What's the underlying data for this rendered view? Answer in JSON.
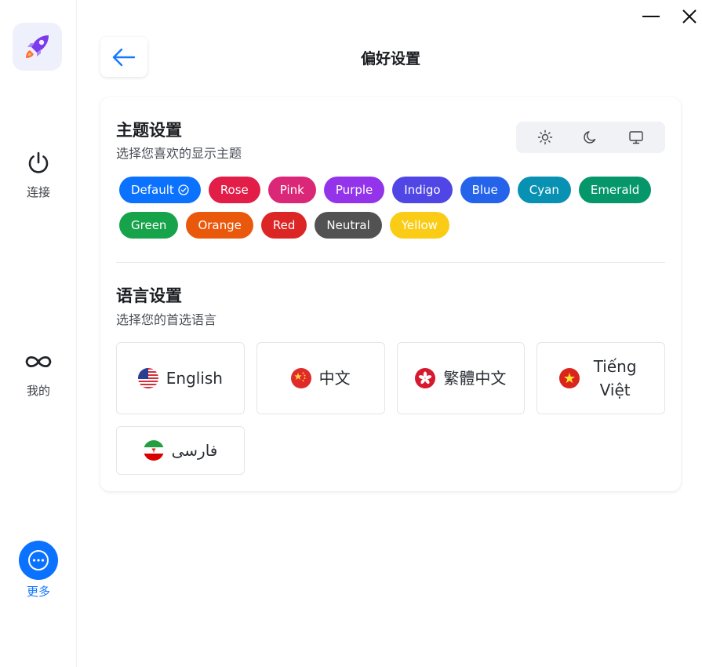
{
  "header": {
    "title": "偏好设置"
  },
  "sidebar": {
    "items": [
      {
        "label": "连接",
        "icon": "power-icon"
      },
      {
        "label": "我的",
        "icon": "infinity-icon"
      },
      {
        "label": "更多",
        "icon": "more-icon",
        "active": true
      }
    ]
  },
  "theme": {
    "title": "主题设置",
    "subtitle": "选择您喜欢的显示主题",
    "modes": [
      "sun-icon",
      "moon-icon",
      "monitor-icon"
    ],
    "colors": [
      {
        "label": "Default",
        "color": "#0a72ff",
        "selected": true
      },
      {
        "label": "Rose",
        "color": "#e11d48"
      },
      {
        "label": "Pink",
        "color": "#db2777"
      },
      {
        "label": "Purple",
        "color": "#9333ea"
      },
      {
        "label": "Indigo",
        "color": "#4f46e5"
      },
      {
        "label": "Blue",
        "color": "#2563eb"
      },
      {
        "label": "Cyan",
        "color": "#0891b2"
      },
      {
        "label": "Emerald",
        "color": "#059669"
      },
      {
        "label": "Green",
        "color": "#16a34a"
      },
      {
        "label": "Orange",
        "color": "#ea580c"
      },
      {
        "label": "Red",
        "color": "#dc2626"
      },
      {
        "label": "Neutral",
        "color": "#525252"
      },
      {
        "label": "Yellow",
        "color": "#facc15"
      }
    ]
  },
  "language": {
    "title": "语言设置",
    "subtitle": "选择您的首选语言",
    "options": [
      {
        "label": "English",
        "flag": "us-flag-icon"
      },
      {
        "label": "中文",
        "flag": "cn-flag-icon"
      },
      {
        "label": "繁體中文",
        "flag": "hk-flag-icon"
      },
      {
        "label": "Tiếng Việt",
        "flag": "vn-flag-icon"
      },
      {
        "label": "فارسی",
        "flag": "ir-flag-icon"
      }
    ]
  }
}
